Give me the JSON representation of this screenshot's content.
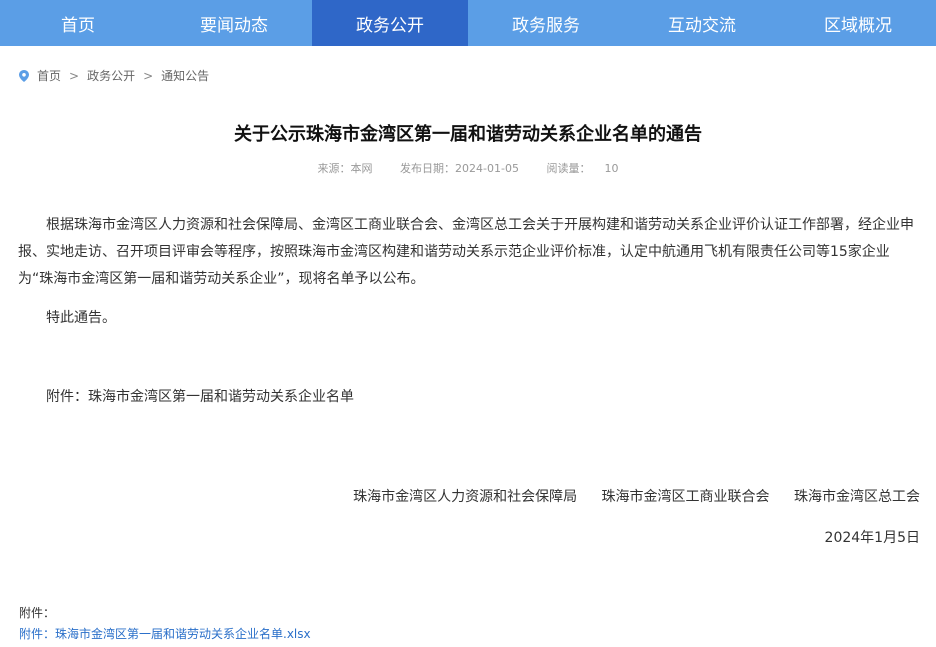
{
  "nav": {
    "items": [
      {
        "label": "首页"
      },
      {
        "label": "要闻动态"
      },
      {
        "label": "政务公开",
        "active": true
      },
      {
        "label": "政务服务"
      },
      {
        "label": "互动交流"
      },
      {
        "label": "区域概况"
      }
    ]
  },
  "breadcrumb": {
    "icon": "location-pin-icon",
    "items": [
      "首页",
      "政务公开",
      "通知公告"
    ],
    "separator": ">"
  },
  "article": {
    "title": "关于公示珠海市金湾区第一届和谐劳动关系企业名单的通告",
    "source_label": "来源：本网",
    "date_label": "发布日期：2024-01-05",
    "views_label": "阅读量：",
    "views_value": "10",
    "paragraphs": [
      "根据珠海市金湾区人力资源和社会保障局、金湾区工商业联合会、金湾区总工会关于开展构建和谐劳动关系企业评价认证工作部署，经企业申报、实地走访、召开项目评审会等程序，按照珠海市金湾区构建和谐劳动关系示范企业评价标准，认定中航通用飞机有限责任公司等15家企业为“珠海市金湾区第一届和谐劳动关系企业”，现将名单予以公布。",
      "特此通告。",
      "附件：珠海市金湾区第一届和谐劳动关系企业名单"
    ],
    "signatories": [
      "珠海市金湾区人力资源和社会保障局",
      "珠海市金湾区工商业联合会",
      "珠海市金湾区总工会"
    ],
    "sign_date": "2024年1月5日"
  },
  "attachments": {
    "label": "附件：",
    "link_text": "附件：珠海市金湾区第一届和谐劳动关系企业名单.xlsx"
  },
  "colors": {
    "nav_bg": "#5b9ee6",
    "nav_active": "#2f67c8",
    "link": "#2a6fc9"
  }
}
